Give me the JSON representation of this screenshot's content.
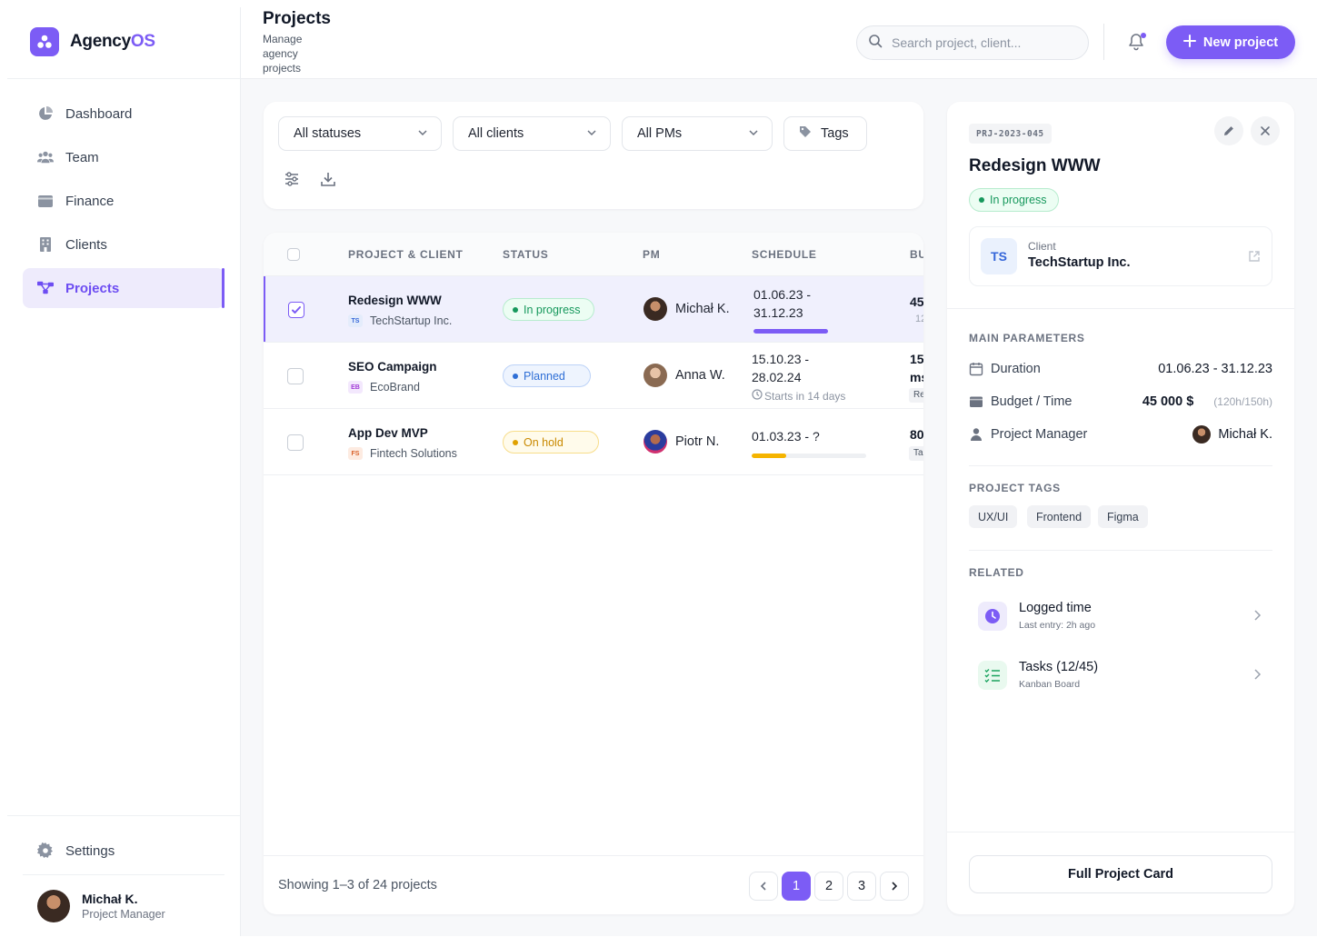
{
  "brand": {
    "name_main": "Agency",
    "name_accent": "OS"
  },
  "sidebar": {
    "items": [
      {
        "label": "Dashboard",
        "icon": "pie-chart-icon"
      },
      {
        "label": "Team",
        "icon": "users-icon"
      },
      {
        "label": "Finance",
        "icon": "wallet-icon"
      },
      {
        "label": "Clients",
        "icon": "building-icon"
      },
      {
        "label": "Projects",
        "icon": "projects-icon",
        "active": true
      }
    ],
    "settings_label": "Settings",
    "user": {
      "name": "Michał K.",
      "role": "Project Manager"
    }
  },
  "header": {
    "title": "Projects",
    "subtitle": "Manage agency projects",
    "search_placeholder": "Search project, client...",
    "new_button": "New project"
  },
  "filters": {
    "statuses": "All statuses",
    "clients": "All clients",
    "pms": "All PMs",
    "tags": "Tags"
  },
  "table": {
    "columns": [
      "PROJECT & CLIENT",
      "STATUS",
      "PM",
      "SCHEDULE",
      "BU"
    ],
    "rows": [
      {
        "name": "Redesign WWW",
        "client": "TechStartup Inc.",
        "client_code": "TS",
        "status": "In progress",
        "pm": "Michał K.",
        "schedule_start": "01.06.23 -",
        "schedule_end": "31.12.23",
        "progress": 0.75,
        "budget_main": "45",
        "budget_sub": "12",
        "selected": true
      },
      {
        "name": "SEO Campaign",
        "client": "EcoBrand",
        "client_code": "EB",
        "status": "Planned",
        "pm": "Anna W.",
        "schedule_start": "15.10.23 -",
        "schedule_end": "28.02.24",
        "schedule_note": "Starts in 14 days",
        "budget_main": "15",
        "budget_sub": "ms",
        "budget_badge": "Re"
      },
      {
        "name": "App Dev MVP",
        "client": "Fintech Solutions",
        "client_code": "FS",
        "status": "On hold",
        "pm": "Piotr N.",
        "schedule_start": "01.03.23 - ?",
        "progress": 0.3,
        "budget_main": "80",
        "budget_badge": "Ta"
      }
    ],
    "showing": "Showing 1–3 of 24 projects",
    "pages": [
      "1",
      "2",
      "3"
    ]
  },
  "detail": {
    "code": "PRJ-2023-045",
    "title": "Redesign WWW",
    "status": "In progress",
    "client_label": "Client",
    "client_name": "TechStartup Inc.",
    "client_code": "TS",
    "main_params_title": "MAIN PARAMETERS",
    "duration_label": "Duration",
    "duration_value": "01.06.23 - 31.12.23",
    "budget_label": "Budget / Time",
    "budget_value": "45 000 $",
    "budget_time": "(120h/150h)",
    "pm_label": "Project Manager",
    "pm_value": "Michał K.",
    "tags_title": "PROJECT TAGS",
    "tags": [
      "UX/UI",
      "Frontend",
      "Figma"
    ],
    "related_title": "RELATED",
    "related": [
      {
        "title": "Logged time",
        "sub": "Last entry: 2h ago"
      },
      {
        "title": "Tasks (12/45)",
        "sub": "Kanban Board"
      }
    ],
    "full_card_button": "Full Project Card"
  },
  "colors": {
    "accent": "#7c5cf5",
    "in_progress": "#16985c",
    "planned": "#2f6fd6",
    "on_hold": "#d99400"
  }
}
